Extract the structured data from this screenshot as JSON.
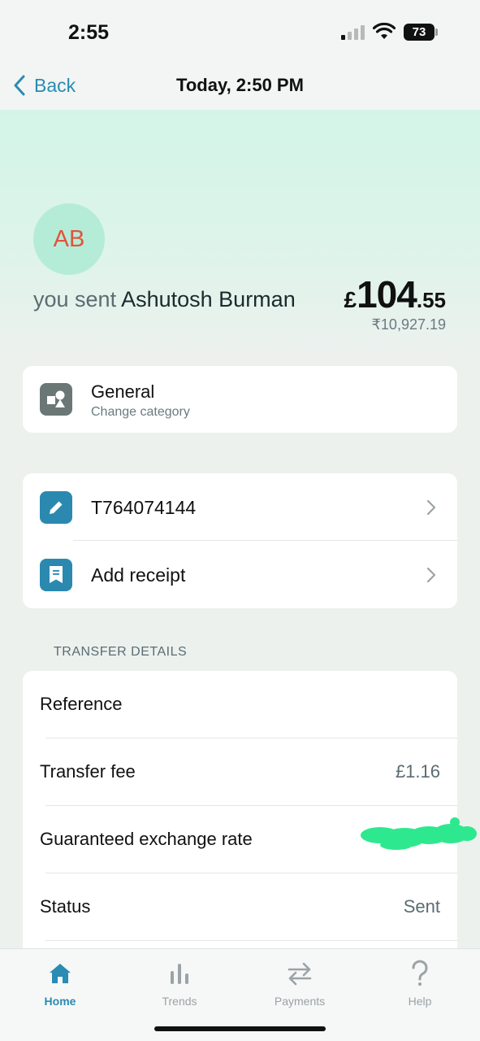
{
  "status_bar": {
    "time": "2:55",
    "battery": "73"
  },
  "nav": {
    "back_label": "Back",
    "title": "Today, 2:50 PM"
  },
  "hero": {
    "avatar_initials": "AB",
    "sent_prefix": "you sent",
    "recipient": "Ashutosh Burman",
    "amount_currency": "£",
    "amount_major": "104",
    "amount_minor": ".55",
    "converted_amount": "₹10,927.19"
  },
  "category": {
    "title": "General",
    "subtitle": "Change category"
  },
  "actions": [
    {
      "label": "T764074144",
      "icon": "pencil-icon"
    },
    {
      "label": "Add receipt",
      "icon": "receipt-icon"
    }
  ],
  "transfer_details": {
    "section_title": "TRANSFER DETAILS",
    "rows": [
      {
        "label": "Reference",
        "value": ""
      },
      {
        "label": "Transfer fee",
        "value": "£1.16"
      },
      {
        "label": "Guaranteed exchange rate",
        "value": ""
      },
      {
        "label": "Status",
        "value": "Sent"
      }
    ]
  },
  "tabs": [
    {
      "label": "Home",
      "icon": "home-icon",
      "active": true
    },
    {
      "label": "Trends",
      "icon": "bar-chart-icon",
      "active": false
    },
    {
      "label": "Payments",
      "icon": "transfer-arrows-icon",
      "active": false
    },
    {
      "label": "Help",
      "icon": "question-icon",
      "active": false
    }
  ],
  "colors": {
    "accent": "#2a8bb3",
    "avatar_bg": "#b5ecd8",
    "avatar_text": "#e2533c",
    "redaction": "#2ee88f"
  }
}
